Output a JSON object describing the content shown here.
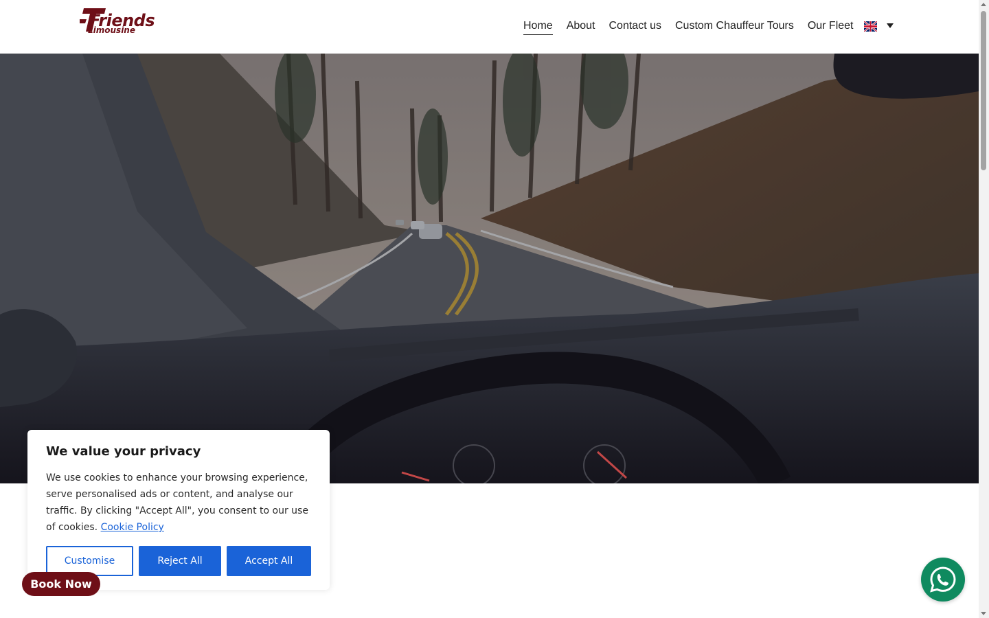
{
  "header": {
    "logo": {
      "word_main": "Friends",
      "word_sub": "Limousine",
      "brand_color": "#6e0f17"
    },
    "nav": [
      {
        "label": "Home",
        "active": true
      },
      {
        "label": "About",
        "active": false
      },
      {
        "label": "Contact us",
        "active": false
      },
      {
        "label": "Custom Chauffeur Tours",
        "active": false
      },
      {
        "label": "Our Fleet",
        "active": false
      }
    ],
    "language": {
      "flag": "uk-flag-icon",
      "dropdown_icon": "caret-down-icon"
    }
  },
  "hero": {
    "image": "car-interior-driving-forest-road"
  },
  "cookie_banner": {
    "title": "We value your privacy",
    "text": "We use cookies to enhance your browsing experience, serve personalised ads or content, and analyse our traffic. By clicking \"Accept All\", you consent to our use of cookies.",
    "link_label": "Cookie Policy",
    "buttons": {
      "customise": "Customise",
      "reject": "Reject All",
      "accept": "Accept All"
    },
    "accent_color": "#1a63d8"
  },
  "floating": {
    "book_now_label": "Book Now",
    "whatsapp_icon": "whatsapp-icon",
    "whatsapp_color": "#0f8a5f"
  }
}
